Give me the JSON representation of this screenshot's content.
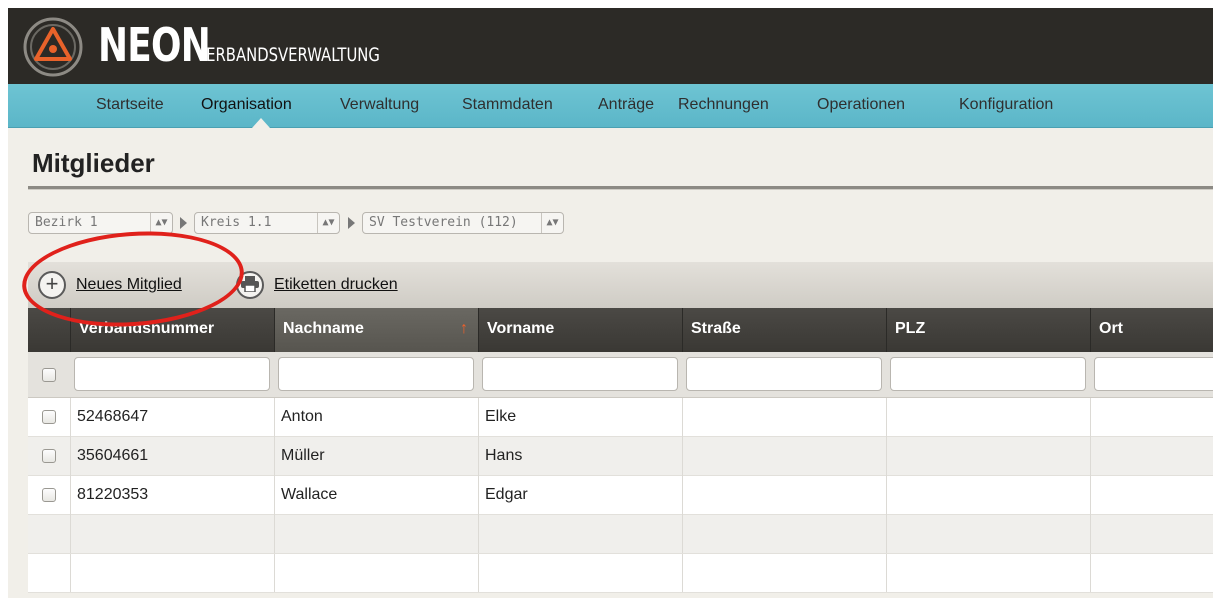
{
  "brand": {
    "name": "NEON",
    "subtitle": "VERBANDSVERWALTUNG"
  },
  "nav": {
    "items": [
      {
        "label": "Startseite"
      },
      {
        "label": "Organisation",
        "active": true
      },
      {
        "label": "Verwaltung"
      },
      {
        "label": "Stammdaten"
      },
      {
        "label": "Anträge"
      },
      {
        "label": "Rechnungen"
      },
      {
        "label": "Operationen"
      },
      {
        "label": "Konfiguration"
      }
    ]
  },
  "page": {
    "title": "Mitglieder"
  },
  "filters": {
    "bezirk": "Bezirk 1",
    "kreis": "Kreis 1.1",
    "verein": "SV Testverein (112)"
  },
  "toolbar": {
    "new_member": "Neues Mitglied",
    "print_labels": "Etiketten drucken"
  },
  "table": {
    "columns": [
      "Verbandsnummer",
      "Nachname",
      "Vorname",
      "Straße",
      "PLZ",
      "Ort"
    ],
    "sorted_column": "Nachname",
    "rows": [
      [
        "52468647",
        "Anton",
        "Elke",
        "",
        "",
        ""
      ],
      [
        "35604661",
        "Müller",
        "Hans",
        "",
        "",
        ""
      ],
      [
        "81220353",
        "Wallace",
        "Edgar",
        "",
        "",
        ""
      ]
    ]
  },
  "colors": {
    "header_bg": "#2c2a26",
    "nav_bg": "#5bb6c8",
    "accent_sort": "#f0602a",
    "annotation_ring": "#e0211b"
  }
}
